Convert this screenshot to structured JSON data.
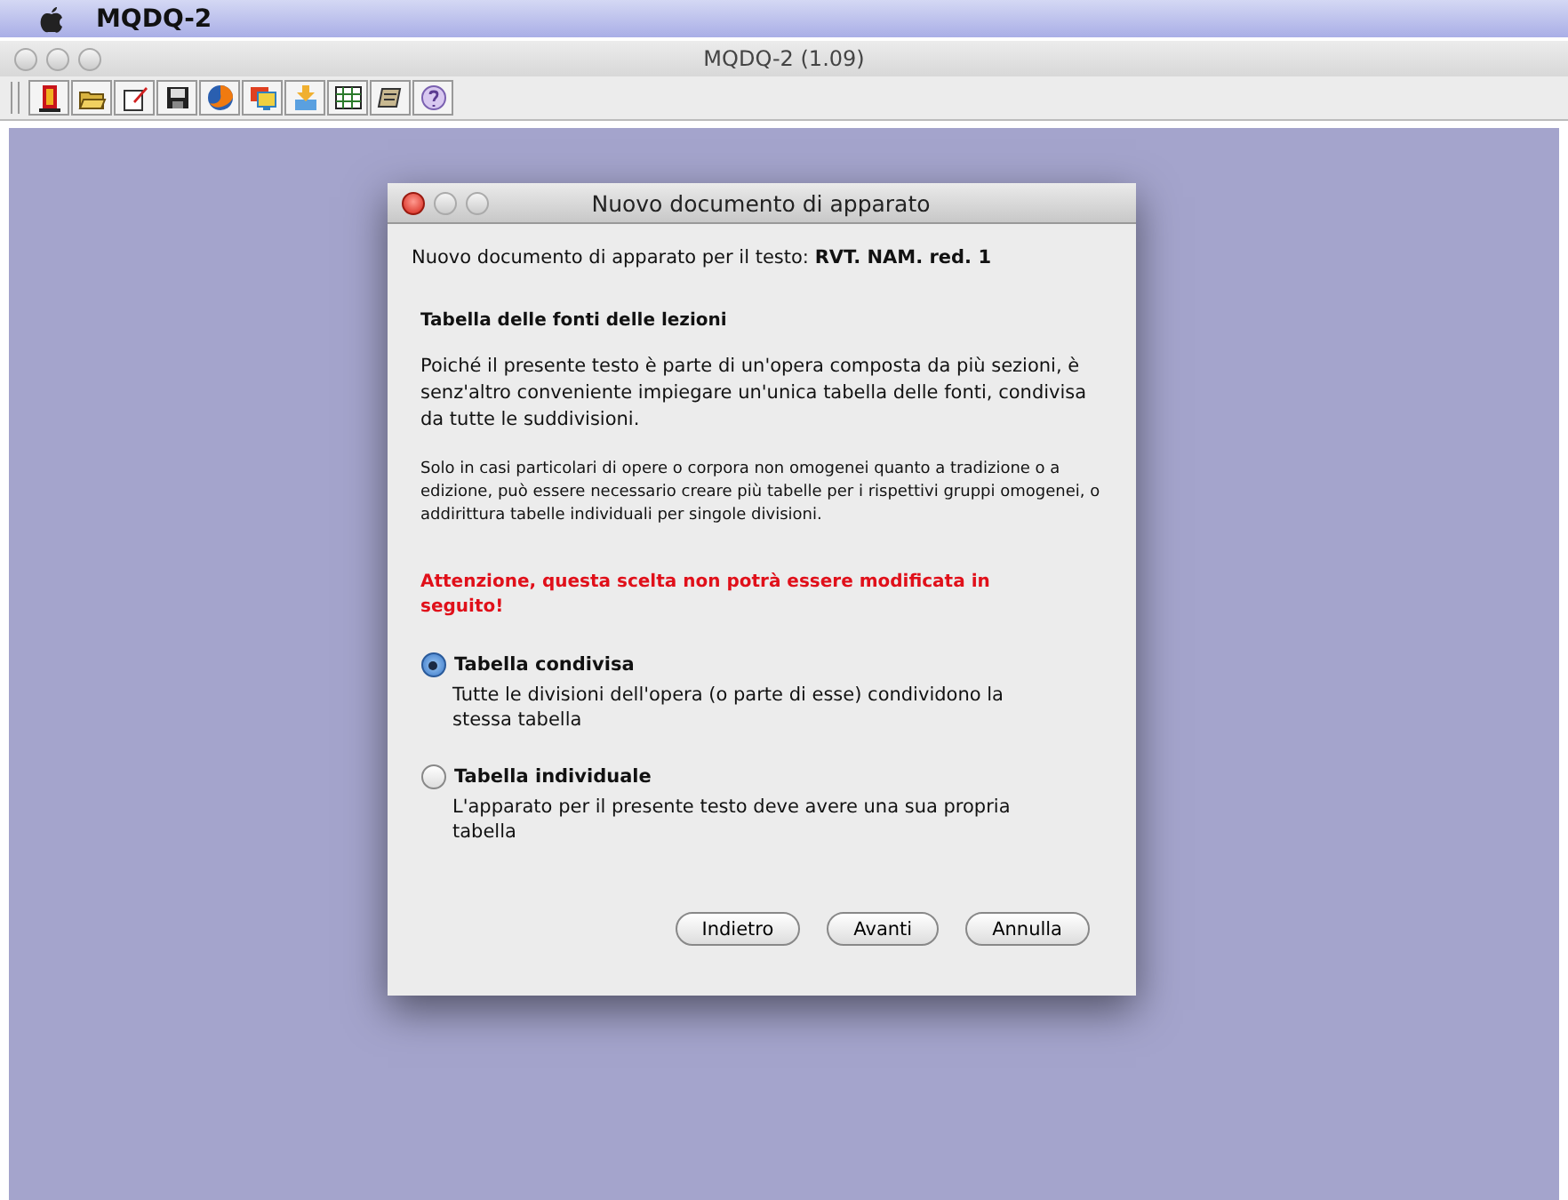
{
  "menubar": {
    "app_name": "MQDQ-2"
  },
  "window": {
    "title": "MQDQ-2 (1.09)"
  },
  "dialog": {
    "title": "Nuovo documento di apparato",
    "intro": "Nuovo documento di apparato per il testo: **RVT. NAM. red. 1**",
    "heading": "Tabella delle fonti delle lezioni",
    "paragraph": "Poiché il presente testo è parte di un'opera composta da più sezioni, è senz'altro conveniente impiegare un'unica tabella delle fonti, condivisa da tutte le suddivisioni.",
    "note": "Solo in casi particolari di opere o corpora non omogenei quanto a tradizione o a edizione, può essere necessario creare più tabelle per i rispettivi gruppi omogenei, o addirittura tabelle individuali per singole divisioni.",
    "warning": "Attenzione, questa scelta non potrà essere modificata in seguito!",
    "options": [
      {
        "label": "Tabella condivisa",
        "description": "Tutte le divisioni dell'opera (o parte di esse) condividono la stessa tabella",
        "selected": true
      },
      {
        "label": "Tabella individuale",
        "description": "L'apparato per il presente testo deve avere una sua propria tabella",
        "selected": false
      }
    ],
    "buttons": [
      "Indietro",
      "Avanti",
      "Annulla"
    ]
  }
}
